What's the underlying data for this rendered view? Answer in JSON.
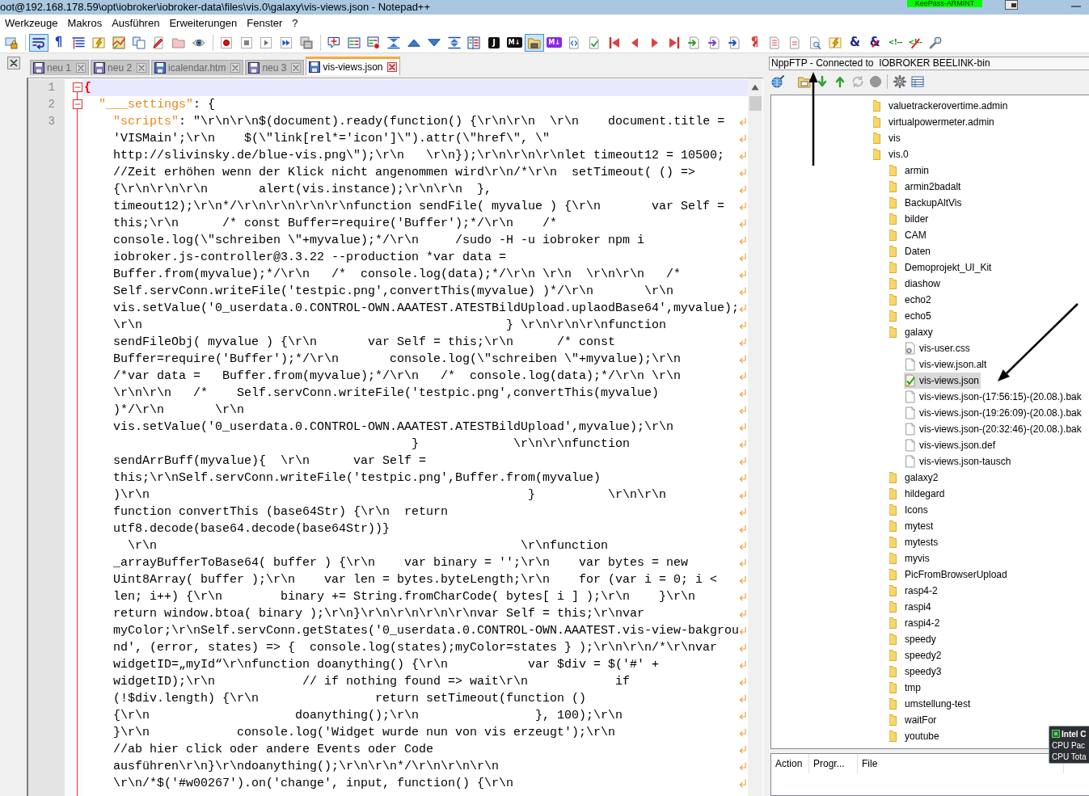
{
  "title_bar": {
    "title": "oot@192.168.178.59\\opt\\iobroker\\iobroker-data\\files\\vis.0\\galaxy\\vis-views.json - Notepad++",
    "overlay_label": "KeePass-ARMINT"
  },
  "menu": [
    "Werkzeuge",
    "Makros",
    "Ausführen",
    "Erweiterungen",
    "Fenster",
    "?"
  ],
  "toolbar": [
    {
      "pressed": false
    },
    {
      "pressed": true
    },
    {
      "pressed": false,
      "glyph": "¶"
    },
    {
      "pressed": false
    },
    {
      "pressed": false
    },
    {
      "pressed": false
    },
    {
      "pressed": false
    },
    {
      "pressed": false
    },
    {
      "pressed": false
    },
    {
      "pressed": false
    },
    {
      "pressed": false
    },
    {
      "pressed": false
    },
    {
      "pressed": false
    },
    {
      "pressed": false
    },
    {
      "pressed": false
    },
    {
      "pressed": false
    },
    {
      "pressed": false
    },
    {
      "pressed": false
    },
    {
      "pressed": false
    },
    {
      "pressed": false
    },
    {
      "pressed": false
    },
    {
      "pressed": false
    },
    {
      "pressed": false
    },
    {
      "pressed": false,
      "glyph": "J"
    },
    {
      "pressed": false,
      "glyph": "M↓"
    },
    {
      "pressed": true
    },
    {
      "pressed": false,
      "glyph": "M↓"
    },
    {
      "pressed": false
    },
    {
      "pressed": false
    },
    {
      "pressed": false
    },
    {
      "pressed": false
    },
    {
      "pressed": false
    },
    {
      "pressed": false
    },
    {
      "pressed": false
    },
    {
      "pressed": false
    },
    {
      "pressed": false
    },
    {
      "pressed": false,
      "glyph": "¶"
    },
    {
      "pressed": false
    },
    {
      "pressed": false
    },
    {
      "pressed": false
    },
    {
      "pressed": false
    },
    {
      "pressed": false,
      "glyph": "&"
    },
    {
      "pressed": false,
      "glyph": "&"
    },
    {
      "pressed": false,
      "glyph": "<!--"
    },
    {
      "pressed": false,
      "glyph": "<!--"
    },
    {
      "pressed": false
    }
  ],
  "tabs": [
    {
      "label": "neu 1",
      "kind": "untitled",
      "selected": false
    },
    {
      "label": "neu 2",
      "kind": "untitled",
      "selected": false
    },
    {
      "label": "icalendar.htm",
      "kind": "file",
      "selected": false
    },
    {
      "label": "neu 3",
      "kind": "untitled",
      "selected": false
    },
    {
      "label": "vis-views.json",
      "kind": "file",
      "selected": true
    }
  ],
  "editor": {
    "lines": [
      {
        "number": "1",
        "current": true,
        "foldable": true,
        "expanded": true,
        "wrapped": false,
        "tokens": [
          {
            "kind": "brace",
            "text": "{"
          }
        ]
      },
      {
        "number": "2",
        "current": false,
        "foldable": true,
        "expanded": true,
        "wrapped": false,
        "tokens": [
          {
            "kind": "property",
            "text": "  \"___settings\""
          },
          {
            "kind": "plain",
            "text": ": {"
          }
        ]
      },
      {
        "number": "3",
        "current": false,
        "foldable": false,
        "wrapped": true,
        "tokens": [
          {
            "kind": "property",
            "text": "    \"scripts\""
          },
          {
            "kind": "plain",
            "text": ": \"\\r\\n\\r\\n$(document).ready(function() {\\r\\n\\r\\n  \\r\\n    document.title ="
          }
        ],
        "continuation": [
          "'VISMain';\\r\\n    $(\\\"link[rel*='icon']\\\").attr(\\\"href\\\", \\\"",
          "http://slivinsky.de/blue-vis.png\\\");\\r\\n   \\r\\n});\\r\\n\\r\\n\\r\\nlet timeout12 = 10500;",
          "//Zeit erhöhen wenn der Klick nicht angenommen wird\\r\\n/*\\r\\n  setTimeout( () =>",
          "{\\r\\n\\r\\n\\r\\n       alert(vis.instance);\\r\\n\\r\\n  },",
          "timeout12);\\r\\n*/\\r\\n\\r\\n\\r\\n\\r\\nfunction sendFile( myvalue ) {\\r\\n       var Self =",
          "this;\\r\\n      /* const Buffer=require('Buffer');*/\\r\\n    /*",
          "console.log(\\\"schreiben \\\"+myvalue);*/\\r\\n     /sudo -H -u iobroker npm i",
          "iobroker.js-controller@3.3.22 --production *var data =",
          "Buffer.from(myvalue);*/\\r\\n   /*  console.log(data);*/\\r\\n \\r\\n  \\r\\n\\r\\n   /*",
          "Self.servConn.writeFile('testpic.png',convertThis(myvalue) )*/\\r\\n       \\r\\n",
          "vis.setValue('0_userdata.0.CONTROL-OWN.AAATEST.ATESTBildUpload.uplaodBase64',myvalue);",
          "\\r\\n                                                  } \\r\\n\\r\\n\\r\\nfunction",
          "sendFileObj( myvalue ) {\\r\\n       var Self = this;\\r\\n      /* const",
          "Buffer=require('Buffer');*/\\r\\n       console.log(\\\"schreiben \\\"+myvalue);\\r\\n",
          "/*var data =   Buffer.from(myvalue);*/\\r\\n   /*  console.log(data);*/\\r\\n \\r\\n",
          "\\r\\n\\r\\n   /*    Self.servConn.writeFile('testpic.png',convertThis(myvalue)",
          ")*/\\r\\n       \\r\\n",
          "vis.setValue('0_userdata.0.CONTROL-OWN.AAATEST.ATESTBildUpload',myvalue);\\r\\n",
          "                                         }             \\r\\n\\r\\nfunction",
          "sendArrBuff(myvalue){  \\r\\n      var Self =",
          "this;\\r\\nSelf.servConn.writeFile('testpic.png',Buffer.from(myvalue)",
          ")\\r\\n                                                    }          \\r\\n\\r\\n",
          "function convertThis (base64Str) {\\r\\n  return",
          "utf8.decode(base64.decode(base64Str))}",
          "  \\r\\n                                                  \\r\\nfunction",
          "_arrayBufferToBase64( buffer ) {\\r\\n    var binary = '';\\r\\n    var bytes = new",
          "Uint8Array( buffer );\\r\\n    var len = bytes.byteLength;\\r\\n    for (var i = 0; i <",
          "len; i++) {\\r\\n        binary += String.fromCharCode( bytes[ i ] );\\r\\n    }\\r\\n",
          "return window.btoa( binary );\\r\\n}\\r\\n\\r\\n\\r\\n\\r\\nvar Self = this;\\r\\nvar",
          "myColor;\\r\\nSelf.servConn.getStates('0_userdata.0.CONTROL-OWN.AAATEST.vis-view-bakgrou",
          "nd', (error, states) => {  console.log(states);myColor=states } );\\r\\n\\r\\n/*\\r\\nvar",
          "widgetID=„myId“\\r\\nfunction doanything() {\\r\\n           var $div = $('#' +",
          "widgetID);\\r\\n            // if nothing found => wait\\r\\n            if",
          "(!$div.length) {\\r\\n                return setTimeout(function ()",
          "{\\r\\n                    doanything();\\r\\n                }, 100);\\r\\n",
          "}\\r\\n            console.log('Widget wurde nun von vis erzeugt');\\r\\n",
          "//ab hier click oder andere Events oder Code",
          "ausführen\\r\\n}\\r\\ndoanything();\\r\\n\\r\\n*/\\r\\n\\r\\n\\r\\n",
          "\\r\\n/*$('#w00267').on('change', input, function() {\\r\\n"
        ]
      }
    ]
  },
  "ftp_panel": {
    "title": "NppFTP - Connected to  IOBROKER BEELINK-bin",
    "toolbar": [
      {
        "disabled": false
      },
      {
        "disabled": false
      },
      {
        "disabled": false
      },
      {
        "disabled": false
      },
      {
        "disabled": true
      },
      {
        "disabled": true
      },
      {
        "disabled": false
      },
      {
        "disabled": false
      }
    ],
    "tree": [
      {
        "label": "valuetrackerovertime.admin",
        "kind": "folder",
        "selected": false
      },
      {
        "label": "virtualpowermeter.admin",
        "kind": "folder",
        "selected": false
      },
      {
        "label": "vis",
        "kind": "folder",
        "selected": false
      },
      {
        "label": "vis.0",
        "kind": "folder",
        "selected": false,
        "children": [
          {
            "label": "armin",
            "kind": "folder",
            "selected": false
          },
          {
            "label": "armin2badalt",
            "kind": "folder",
            "selected": false
          },
          {
            "label": "BackupAltVis",
            "kind": "folder",
            "selected": false
          },
          {
            "label": "bilder",
            "kind": "folder",
            "selected": false
          },
          {
            "label": "CAM",
            "kind": "folder",
            "selected": false
          },
          {
            "label": "Daten",
            "kind": "folder",
            "selected": false
          },
          {
            "label": "Demoprojekt_UI_Kit",
            "kind": "folder",
            "selected": false
          },
          {
            "label": "diashow",
            "kind": "folder",
            "selected": false
          },
          {
            "label": "echo2",
            "kind": "folder",
            "selected": false
          },
          {
            "label": "echo5",
            "kind": "folder",
            "selected": false
          },
          {
            "label": "galaxy",
            "kind": "folder",
            "selected": false,
            "children": [
              {
                "label": "vis-user.css",
                "kind": "stylesheet",
                "selected": false
              },
              {
                "label": "vis-view.json.alt",
                "kind": "file",
                "selected": false
              },
              {
                "label": "vis-views.json",
                "kind": "open-file",
                "selected": true
              },
              {
                "label": "vis-views.json-(17:56:15)-(20.08.).bak",
                "kind": "file",
                "selected": false
              },
              {
                "label": "vis-views.json-(19:26:09)-(20.08.).bak",
                "kind": "file",
                "selected": false
              },
              {
                "label": "vis-views.json-(20:32:46)-(20.08.).bak",
                "kind": "file",
                "selected": false
              },
              {
                "label": "vis-views.json.def",
                "kind": "file",
                "selected": false
              },
              {
                "label": "vis-views.json-tausch",
                "kind": "file",
                "selected": false
              }
            ]
          },
          {
            "label": "galaxy2",
            "kind": "folder",
            "selected": false
          },
          {
            "label": "hildegard",
            "kind": "folder",
            "selected": false
          },
          {
            "label": "Icons",
            "kind": "folder",
            "selected": false
          },
          {
            "label": "mytest",
            "kind": "folder",
            "selected": false
          },
          {
            "label": "mytests",
            "kind": "folder",
            "selected": false
          },
          {
            "label": "myvis",
            "kind": "folder",
            "selected": false
          },
          {
            "label": "PicFromBrowserUpload",
            "kind": "folder",
            "selected": false
          },
          {
            "label": "rasp4-2",
            "kind": "folder",
            "selected": false
          },
          {
            "label": "raspi4",
            "kind": "folder",
            "selected": false
          },
          {
            "label": "raspi4-2",
            "kind": "folder",
            "selected": false
          },
          {
            "label": "speedy",
            "kind": "folder",
            "selected": false
          },
          {
            "label": "speedy2",
            "kind": "folder",
            "selected": false
          },
          {
            "label": "speedy3",
            "kind": "folder",
            "selected": false
          },
          {
            "label": "tmp",
            "kind": "folder",
            "selected": false
          },
          {
            "label": "umstellung-test",
            "kind": "folder",
            "selected": false
          },
          {
            "label": "waitFor",
            "kind": "folder",
            "selected": false
          },
          {
            "label": "youtube",
            "kind": "folder",
            "selected": false
          }
        ]
      }
    ],
    "transfer_columns": [
      "Action",
      "Progr...",
      "File"
    ]
  },
  "sensor_tooltip": {
    "title": "Intel C",
    "lines": [
      "CPU Pac",
      "CPU Tota"
    ]
  }
}
